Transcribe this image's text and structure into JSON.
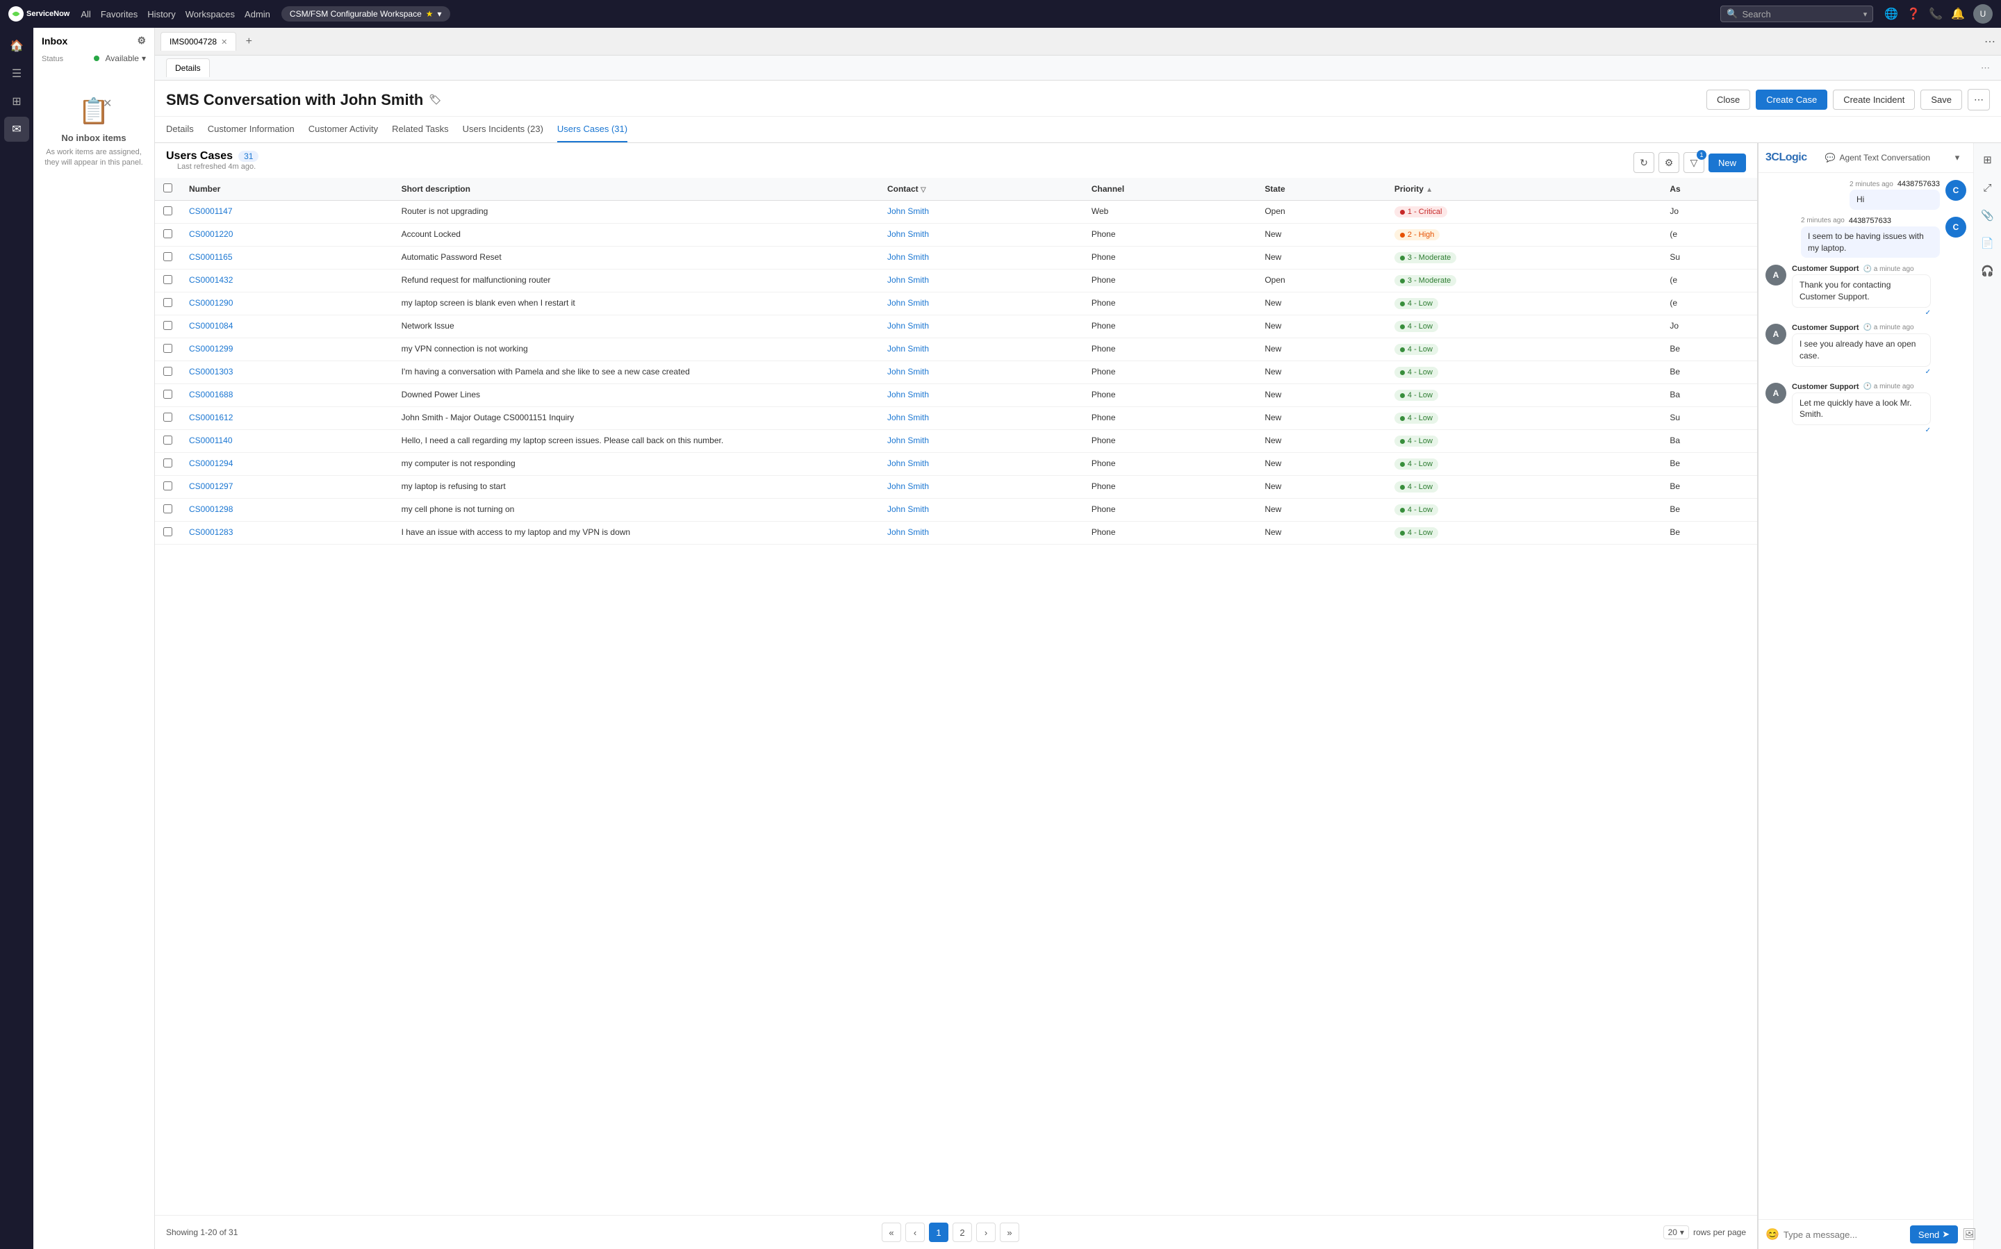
{
  "topNav": {
    "logo": "ServiceNow",
    "items": [
      "All",
      "Favorites",
      "History",
      "Workspaces",
      "Admin"
    ],
    "workspace": "CSM/FSM Configurable Workspace",
    "search_placeholder": "Search",
    "avatar_initials": "U"
  },
  "sidebar": {
    "icons": [
      "home",
      "menu",
      "grid",
      "inbox"
    ]
  },
  "inboxPanel": {
    "title": "Inbox",
    "status_label": "Status",
    "status_value": "Available",
    "empty_icon": "📋",
    "empty_title": "No inbox items",
    "empty_text": "As work items are assigned, they will appear in this panel."
  },
  "tabBar": {
    "tabs": [
      {
        "id": "IMS0004728",
        "label": "IMS0004728"
      }
    ],
    "details_sub_tab": "Details"
  },
  "pageHeader": {
    "title": "SMS Conversation with John Smith",
    "tag_icon": "🏷",
    "actions": {
      "close_label": "Close",
      "create_case_label": "Create Case",
      "create_incident_label": "Create Incident",
      "save_label": "Save"
    }
  },
  "tabs": [
    {
      "id": "details",
      "label": "Details"
    },
    {
      "id": "customer-information",
      "label": "Customer Information"
    },
    {
      "id": "customer-activity",
      "label": "Customer Activity"
    },
    {
      "id": "related-tasks",
      "label": "Related Tasks"
    },
    {
      "id": "users-incidents",
      "label": "Users Incidents (23)"
    },
    {
      "id": "users-cases",
      "label": "Users Cases (31)",
      "active": true
    }
  ],
  "usersCases": {
    "title": "Users Cases",
    "count": 31,
    "last_refreshed": "Last refreshed 4m ago.",
    "new_button": "New",
    "columns": [
      {
        "id": "number",
        "label": "Number"
      },
      {
        "id": "short_description",
        "label": "Short description"
      },
      {
        "id": "contact",
        "label": "Contact"
      },
      {
        "id": "channel",
        "label": "Channel"
      },
      {
        "id": "state",
        "label": "State"
      },
      {
        "id": "priority",
        "label": "Priority"
      },
      {
        "id": "assigned_to",
        "label": "As"
      }
    ],
    "rows": [
      {
        "number": "CS0001147",
        "short_description": "Router is not upgrading",
        "contact": "John Smith",
        "channel": "Web",
        "state": "Open",
        "priority_label": "1 - Critical",
        "priority_class": "priority-1",
        "dot_class": "dot-1",
        "assigned": "Jo"
      },
      {
        "number": "CS0001220",
        "short_description": "Account Locked",
        "contact": "John Smith",
        "channel": "Phone",
        "state": "New",
        "priority_label": "2 - High",
        "priority_class": "priority-2",
        "dot_class": "dot-2",
        "assigned": "(e"
      },
      {
        "number": "CS0001165",
        "short_description": "Automatic Password Reset",
        "contact": "John Smith",
        "channel": "Phone",
        "state": "New",
        "priority_label": "3 - Moderate",
        "priority_class": "priority-3",
        "dot_class": "dot-3",
        "assigned": "Su"
      },
      {
        "number": "CS0001432",
        "short_description": "Refund request for malfunctioning router",
        "contact": "John Smith",
        "channel": "Phone",
        "state": "Open",
        "priority_label": "3 - Moderate",
        "priority_class": "priority-3",
        "dot_class": "dot-3",
        "assigned": "(e"
      },
      {
        "number": "CS0001290",
        "short_description": "my laptop screen is blank even when I restart it",
        "contact": "John Smith",
        "channel": "Phone",
        "state": "New",
        "priority_label": "4 - Low",
        "priority_class": "priority-4",
        "dot_class": "dot-4",
        "assigned": "(e"
      },
      {
        "number": "CS0001084",
        "short_description": "Network Issue",
        "contact": "John Smith",
        "channel": "Phone",
        "state": "New",
        "priority_label": "4 - Low",
        "priority_class": "priority-4",
        "dot_class": "dot-4",
        "assigned": "Jo"
      },
      {
        "number": "CS0001299",
        "short_description": "my VPN connection is not working",
        "contact": "John Smith",
        "channel": "Phone",
        "state": "New",
        "priority_label": "4 - Low",
        "priority_class": "priority-4",
        "dot_class": "dot-4",
        "assigned": "Be"
      },
      {
        "number": "CS0001303",
        "short_description": "I'm having a conversation with Pamela and she like to see a new case created",
        "contact": "John Smith",
        "channel": "Phone",
        "state": "New",
        "priority_label": "4 - Low",
        "priority_class": "priority-4",
        "dot_class": "dot-4",
        "assigned": "Be"
      },
      {
        "number": "CS0001688",
        "short_description": "Downed Power Lines",
        "contact": "John Smith",
        "channel": "Phone",
        "state": "New",
        "priority_label": "4 - Low",
        "priority_class": "priority-4",
        "dot_class": "dot-4",
        "assigned": "Ba"
      },
      {
        "number": "CS0001612",
        "short_description": "John Smith - Major Outage CS0001151 Inquiry",
        "contact": "John Smith",
        "channel": "Phone",
        "state": "New",
        "priority_label": "4 - Low",
        "priority_class": "priority-4",
        "dot_class": "dot-4",
        "assigned": "Su"
      },
      {
        "number": "CS0001140",
        "short_description": "Hello, I need a call regarding my laptop screen issues. Please call back on this number.",
        "contact": "John Smith",
        "channel": "Phone",
        "state": "New",
        "priority_label": "4 - Low",
        "priority_class": "priority-4",
        "dot_class": "dot-4",
        "assigned": "Ba"
      },
      {
        "number": "CS0001294",
        "short_description": "my computer is not responding",
        "contact": "John Smith",
        "channel": "Phone",
        "state": "New",
        "priority_label": "4 - Low",
        "priority_class": "priority-4",
        "dot_class": "dot-4",
        "assigned": "Be"
      },
      {
        "number": "CS0001297",
        "short_description": "my laptop is refusing to start",
        "contact": "John Smith",
        "channel": "Phone",
        "state": "New",
        "priority_label": "4 - Low",
        "priority_class": "priority-4",
        "dot_class": "dot-4",
        "assigned": "Be"
      },
      {
        "number": "CS0001298",
        "short_description": "my cell phone is not turning on",
        "contact": "John Smith",
        "channel": "Phone",
        "state": "New",
        "priority_label": "4 - Low",
        "priority_class": "priority-4",
        "dot_class": "dot-4",
        "assigned": "Be"
      },
      {
        "number": "CS0001283",
        "short_description": "I have an issue with access to my laptop and my VPN is down",
        "contact": "John Smith",
        "channel": "Phone",
        "state": "New",
        "priority_label": "4 - Low",
        "priority_class": "priority-4",
        "dot_class": "dot-4",
        "assigned": "Be"
      }
    ],
    "pagination": {
      "showing": "Showing 1-20 of 31",
      "current_page": 1,
      "pages": [
        "1",
        "2"
      ],
      "rows_per_page": "20",
      "rows_per_page_label": "rows per page"
    }
  },
  "chatPanel": {
    "logo": "3CLogic",
    "header_icon": "💬",
    "title": "Agent Text Conversation",
    "messages": [
      {
        "id": 1,
        "type": "user",
        "avatar": "C",
        "time": "2 minutes ago",
        "phone": "4438757633",
        "text": "Hi"
      },
      {
        "id": 2,
        "type": "user",
        "avatar": "C",
        "time": "2 minutes ago",
        "phone": "4438757633",
        "text": "I seem to be having issues with my laptop."
      },
      {
        "id": 3,
        "type": "agent",
        "avatar": "A",
        "sender": "Customer Support",
        "time": "a minute ago",
        "text": "Thank you for contacting Customer Support."
      },
      {
        "id": 4,
        "type": "agent",
        "avatar": "A",
        "sender": "Customer Support",
        "time": "a minute ago",
        "text": "I see you already have an open case."
      },
      {
        "id": 5,
        "type": "agent",
        "avatar": "A",
        "sender": "Customer Support",
        "time": "a minute ago",
        "text": "Let me quickly have a look Mr. Smith."
      }
    ],
    "send_label": "Send",
    "footer_icons": [
      "emoji",
      "image"
    ]
  }
}
